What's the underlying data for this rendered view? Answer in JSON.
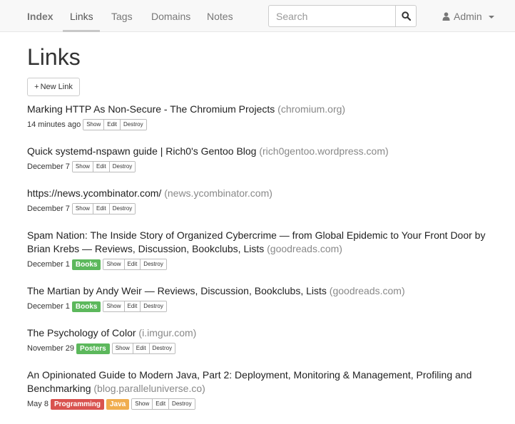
{
  "navbar": {
    "brand": "Index",
    "items": [
      {
        "label": "Links",
        "active": true
      },
      {
        "label": "Tags",
        "active": false
      },
      {
        "label": "Domains",
        "active": false
      },
      {
        "label": "Notes",
        "active": false
      }
    ],
    "search_placeholder": "Search",
    "user_label": "Admin"
  },
  "page": {
    "title": "Links",
    "new_link_label": "New Link",
    "new_link_prefix": "+"
  },
  "actions": {
    "show": "Show",
    "edit": "Edit",
    "destroy": "Destroy"
  },
  "tag_colors": {
    "success": "#5cb85c",
    "danger": "#d9534f",
    "warning": "#f0ad4e"
  },
  "links": [
    {
      "title": "Marking HTTP As Non-Secure - The Chromium Projects",
      "domain": "(chromium.org)",
      "time": "14 minutes ago",
      "tags": []
    },
    {
      "title": "Quick systemd-nspawn guide | Rich0's Gentoo Blog",
      "domain": "(rich0gentoo.wordpress.com)",
      "time": "December 7",
      "tags": []
    },
    {
      "title": "https://news.ycombinator.com/",
      "domain": "(news.ycombinator.com)",
      "time": "December 7",
      "tags": []
    },
    {
      "title": "Spam Nation: The Inside Story of Organized Cybercrime — from Global Epidemic to Your Front Door by Brian Krebs — Reviews, Discussion, Bookclubs, Lists",
      "domain": "(goodreads.com)",
      "time": "December 1",
      "tags": [
        {
          "label": "Books",
          "color": "success"
        }
      ]
    },
    {
      "title": "The Martian by Andy Weir — Reviews, Discussion, Bookclubs, Lists",
      "domain": "(goodreads.com)",
      "time": "December 1",
      "tags": [
        {
          "label": "Books",
          "color": "success"
        }
      ]
    },
    {
      "title": "The Psychology of Color",
      "domain": "(i.imgur.com)",
      "time": "November 29",
      "tags": [
        {
          "label": "Posters",
          "color": "success"
        }
      ]
    },
    {
      "title": "An Opinionated Guide to Modern Java, Part 2: Deployment, Monitoring & Management, Profiling and Benchmarking",
      "domain": "(blog.paralleluniverse.co)",
      "time": "May 8",
      "tags": [
        {
          "label": "Programming",
          "color": "danger"
        },
        {
          "label": "Java",
          "color": "warning"
        }
      ]
    }
  ]
}
